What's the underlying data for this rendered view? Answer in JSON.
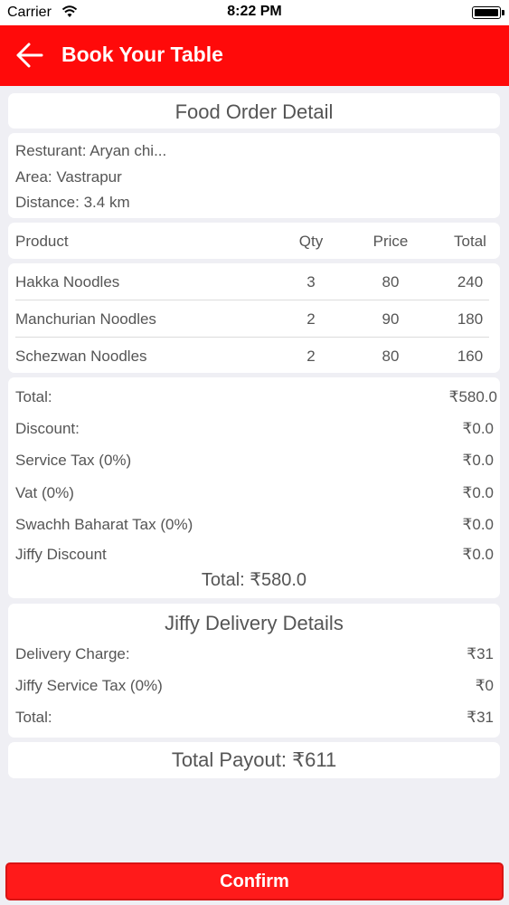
{
  "status": {
    "carrier": "Carrier",
    "time": "8:22 PM"
  },
  "nav": {
    "title": "Book Your Table"
  },
  "order": {
    "heading": "Food Order Detail",
    "restaurant": "Resturant: Aryan chi...",
    "area": "Area: Vastrapur",
    "distance": "Distance: 3.4 km"
  },
  "table": {
    "headers": {
      "product": "Product",
      "qty": "Qty",
      "price": "Price",
      "total": "Total"
    },
    "rows": [
      {
        "product": "Hakka Noodles",
        "qty": "3",
        "price": "80",
        "total": "240"
      },
      {
        "product": "Manchurian Noodles",
        "qty": "2",
        "price": "90",
        "total": "180"
      },
      {
        "product": "Schezwan Noodles",
        "qty": "2",
        "price": "80",
        "total": "160"
      }
    ]
  },
  "summary": {
    "total_label": "Total:",
    "total_value": "₹580.0",
    "discount_label": "Discount:",
    "discount_value": "₹0.0",
    "service_tax_label": "Service Tax (0%)",
    "service_tax_value": "₹0.0",
    "vat_label": "Vat (0%)",
    "vat_value": "₹0.0",
    "swachh_label": "Swachh Baharat Tax (0%)",
    "swachh_value": "₹0.0",
    "jiffy_discount_label": "Jiffy Discount",
    "jiffy_discount_value": "₹0.0",
    "grand_total": "Total: ₹580.0"
  },
  "delivery": {
    "heading": "Jiffy Delivery Details",
    "charge_label": "Delivery Charge:",
    "charge_value": "₹31",
    "tax_label": "Jiffy Service Tax (0%)",
    "tax_value": "₹0",
    "total_label": "Total:",
    "total_value": "₹31"
  },
  "payout": {
    "label": "Total Payout: ₹611"
  },
  "confirm": {
    "label": "Confirm"
  },
  "colors": {
    "accent": "#ff0a0a",
    "background": "#efeff4"
  }
}
